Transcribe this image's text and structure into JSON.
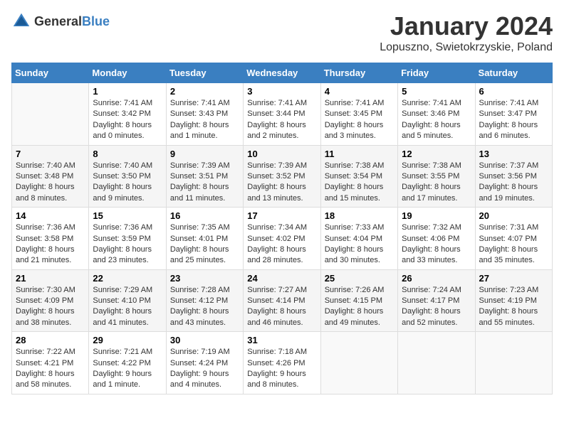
{
  "logo": {
    "general": "General",
    "blue": "Blue"
  },
  "header": {
    "month": "January 2024",
    "location": "Lopuszno, Swietokrzyskie, Poland"
  },
  "weekdays": [
    "Sunday",
    "Monday",
    "Tuesday",
    "Wednesday",
    "Thursday",
    "Friday",
    "Saturday"
  ],
  "weeks": [
    [
      {
        "day": "",
        "info": ""
      },
      {
        "day": "1",
        "info": "Sunrise: 7:41 AM\nSunset: 3:42 PM\nDaylight: 8 hours\nand 0 minutes."
      },
      {
        "day": "2",
        "info": "Sunrise: 7:41 AM\nSunset: 3:43 PM\nDaylight: 8 hours\nand 1 minute."
      },
      {
        "day": "3",
        "info": "Sunrise: 7:41 AM\nSunset: 3:44 PM\nDaylight: 8 hours\nand 2 minutes."
      },
      {
        "day": "4",
        "info": "Sunrise: 7:41 AM\nSunset: 3:45 PM\nDaylight: 8 hours\nand 3 minutes."
      },
      {
        "day": "5",
        "info": "Sunrise: 7:41 AM\nSunset: 3:46 PM\nDaylight: 8 hours\nand 5 minutes."
      },
      {
        "day": "6",
        "info": "Sunrise: 7:41 AM\nSunset: 3:47 PM\nDaylight: 8 hours\nand 6 minutes."
      }
    ],
    [
      {
        "day": "7",
        "info": "Sunrise: 7:40 AM\nSunset: 3:48 PM\nDaylight: 8 hours\nand 8 minutes."
      },
      {
        "day": "8",
        "info": "Sunrise: 7:40 AM\nSunset: 3:50 PM\nDaylight: 8 hours\nand 9 minutes."
      },
      {
        "day": "9",
        "info": "Sunrise: 7:39 AM\nSunset: 3:51 PM\nDaylight: 8 hours\nand 11 minutes."
      },
      {
        "day": "10",
        "info": "Sunrise: 7:39 AM\nSunset: 3:52 PM\nDaylight: 8 hours\nand 13 minutes."
      },
      {
        "day": "11",
        "info": "Sunrise: 7:38 AM\nSunset: 3:54 PM\nDaylight: 8 hours\nand 15 minutes."
      },
      {
        "day": "12",
        "info": "Sunrise: 7:38 AM\nSunset: 3:55 PM\nDaylight: 8 hours\nand 17 minutes."
      },
      {
        "day": "13",
        "info": "Sunrise: 7:37 AM\nSunset: 3:56 PM\nDaylight: 8 hours\nand 19 minutes."
      }
    ],
    [
      {
        "day": "14",
        "info": "Sunrise: 7:36 AM\nSunset: 3:58 PM\nDaylight: 8 hours\nand 21 minutes."
      },
      {
        "day": "15",
        "info": "Sunrise: 7:36 AM\nSunset: 3:59 PM\nDaylight: 8 hours\nand 23 minutes."
      },
      {
        "day": "16",
        "info": "Sunrise: 7:35 AM\nSunset: 4:01 PM\nDaylight: 8 hours\nand 25 minutes."
      },
      {
        "day": "17",
        "info": "Sunrise: 7:34 AM\nSunset: 4:02 PM\nDaylight: 8 hours\nand 28 minutes."
      },
      {
        "day": "18",
        "info": "Sunrise: 7:33 AM\nSunset: 4:04 PM\nDaylight: 8 hours\nand 30 minutes."
      },
      {
        "day": "19",
        "info": "Sunrise: 7:32 AM\nSunset: 4:06 PM\nDaylight: 8 hours\nand 33 minutes."
      },
      {
        "day": "20",
        "info": "Sunrise: 7:31 AM\nSunset: 4:07 PM\nDaylight: 8 hours\nand 35 minutes."
      }
    ],
    [
      {
        "day": "21",
        "info": "Sunrise: 7:30 AM\nSunset: 4:09 PM\nDaylight: 8 hours\nand 38 minutes."
      },
      {
        "day": "22",
        "info": "Sunrise: 7:29 AM\nSunset: 4:10 PM\nDaylight: 8 hours\nand 41 minutes."
      },
      {
        "day": "23",
        "info": "Sunrise: 7:28 AM\nSunset: 4:12 PM\nDaylight: 8 hours\nand 43 minutes."
      },
      {
        "day": "24",
        "info": "Sunrise: 7:27 AM\nSunset: 4:14 PM\nDaylight: 8 hours\nand 46 minutes."
      },
      {
        "day": "25",
        "info": "Sunrise: 7:26 AM\nSunset: 4:15 PM\nDaylight: 8 hours\nand 49 minutes."
      },
      {
        "day": "26",
        "info": "Sunrise: 7:24 AM\nSunset: 4:17 PM\nDaylight: 8 hours\nand 52 minutes."
      },
      {
        "day": "27",
        "info": "Sunrise: 7:23 AM\nSunset: 4:19 PM\nDaylight: 8 hours\nand 55 minutes."
      }
    ],
    [
      {
        "day": "28",
        "info": "Sunrise: 7:22 AM\nSunset: 4:21 PM\nDaylight: 8 hours\nand 58 minutes."
      },
      {
        "day": "29",
        "info": "Sunrise: 7:21 AM\nSunset: 4:22 PM\nDaylight: 9 hours\nand 1 minute."
      },
      {
        "day": "30",
        "info": "Sunrise: 7:19 AM\nSunset: 4:24 PM\nDaylight: 9 hours\nand 4 minutes."
      },
      {
        "day": "31",
        "info": "Sunrise: 7:18 AM\nSunset: 4:26 PM\nDaylight: 9 hours\nand 8 minutes."
      },
      {
        "day": "",
        "info": ""
      },
      {
        "day": "",
        "info": ""
      },
      {
        "day": "",
        "info": ""
      }
    ]
  ]
}
